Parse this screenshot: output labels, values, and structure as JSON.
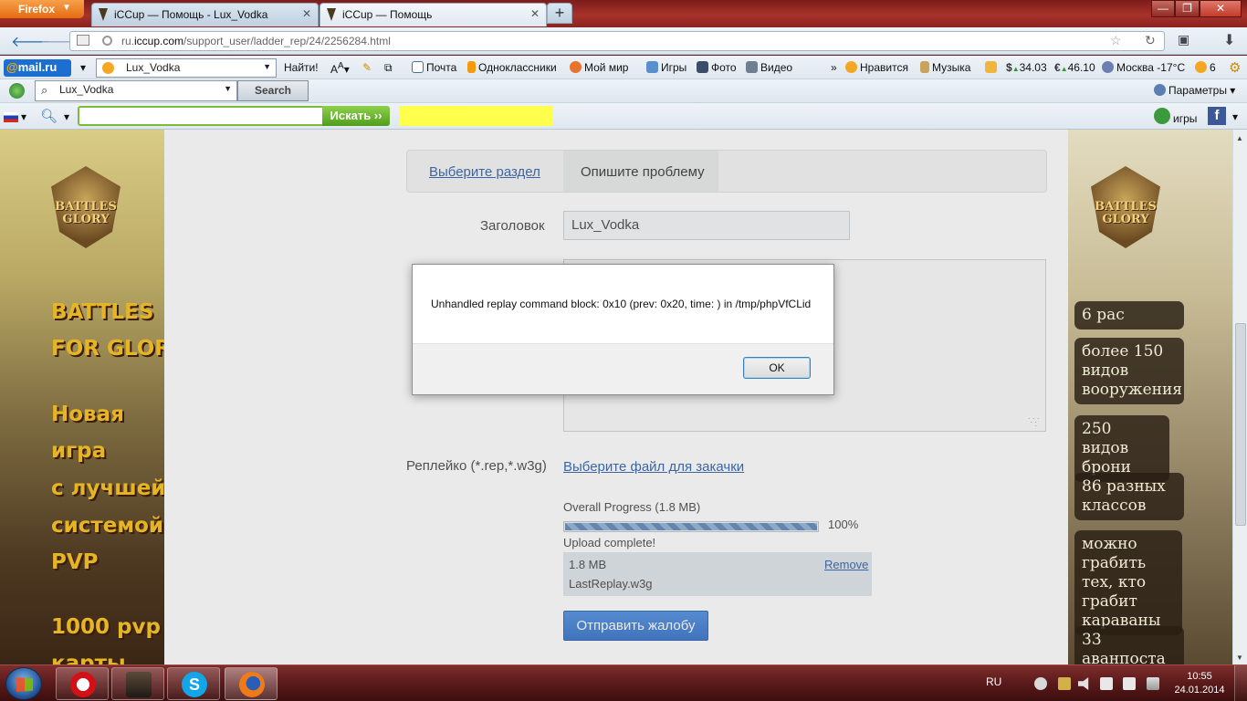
{
  "browser": {
    "menu_label": "Firefox",
    "tabs": [
      {
        "title": "iCCup — Помощь - Lux_Vodka"
      },
      {
        "title": "iCCup — Помощь"
      }
    ],
    "new_tab_label": "+",
    "window_buttons": {
      "minimize": "—",
      "maximize": "❐",
      "close": "✕"
    },
    "url_prefix": "ru.",
    "url_domain": "iccup.com",
    "url_path": "/support_user/ladder_rep/24/2256284.html"
  },
  "mailru_toolbar": {
    "logo_at": "@",
    "logo_text": "mail.ru",
    "user_combo": "Lux_Vodka",
    "find_label": "Найти!",
    "links": [
      "Почта",
      "Одноклассники",
      "Мой мир",
      "Игры",
      "Фото",
      "Видео"
    ],
    "overflow": "»",
    "like_label": "Нравится",
    "music_label": "Музыка",
    "usd_rate": "34.03",
    "eur_rate": "46.10",
    "weather": "Москва -17°C",
    "mail_count": "6"
  },
  "search_toolbar": {
    "query": "Lux_Vodka",
    "search_label": "Search",
    "params_label": "Параметры"
  },
  "search_toolbar_2": {
    "button_label": "Искать ››",
    "games_label": "игры",
    "facebook_label": "f"
  },
  "ads": {
    "logo_lines": [
      "BATTLES",
      "GLORY"
    ],
    "left_lines": [
      "BATTLES",
      "FOR GLORY",
      "Новая",
      "игра",
      "с лучшей",
      "системой",
      "PVP",
      "1000 pvp",
      "карты"
    ],
    "right_badges": [
      "6 рас",
      "более 150 видов вооружения",
      "250 видов брони",
      "86 разных классов",
      "можно грабить тех, кто грабит караваны",
      "33 аванпоста"
    ]
  },
  "form": {
    "tab_choose": "Выберите раздел",
    "tab_describe": "Опишите проблему",
    "title_label": "Заголовок",
    "title_value": "Lux_Vodka",
    "replay_label": "Реплейко (*.rep,*.w3g)",
    "choose_file": "Выберите файл для закачки",
    "progress_label": "Overall Progress (1.8 MB)",
    "progress_value": 100,
    "progress_pct": "100%",
    "upload_status": "Upload complete!",
    "file_size": "1.8 MB",
    "file_remove": "Remove",
    "file_name": "LastReplay.w3g",
    "submit": "Отправить жалобу"
  },
  "dialog": {
    "message": "Unhandled replay command block: 0x10 (prev: 0x20, time: ) in /tmp/phpVfCLid",
    "ok": "OK"
  },
  "taskbar": {
    "language": "RU",
    "time": "10:55",
    "date": "24.01.2014"
  },
  "colors": {
    "link": "#2b5ea9",
    "submit": "#2f6fc8",
    "ad_text": "#e6b524",
    "titlebar": "#a8322a"
  }
}
